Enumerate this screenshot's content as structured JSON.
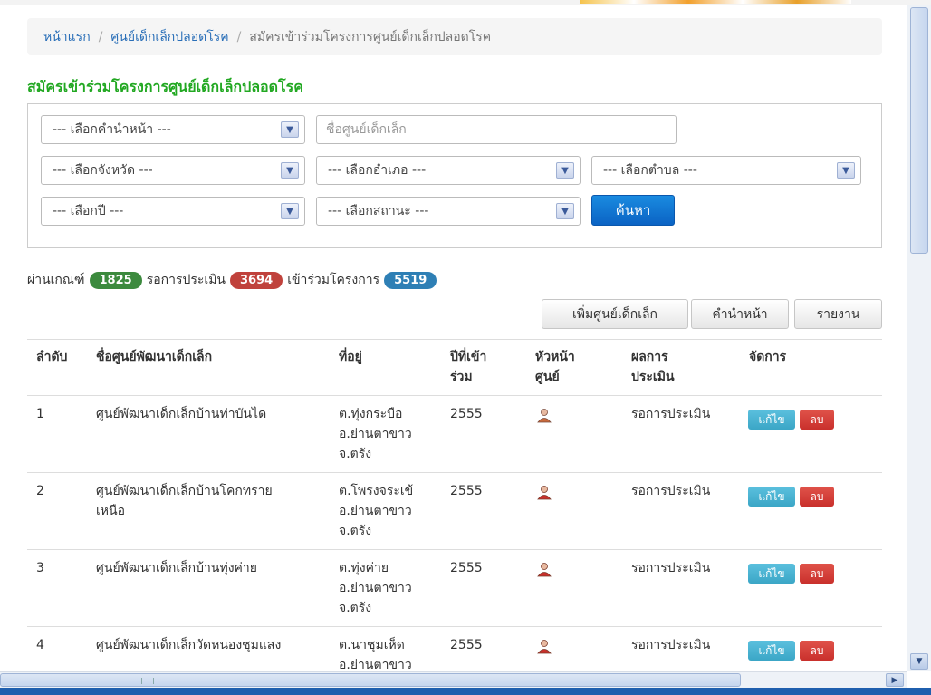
{
  "breadcrumb": {
    "home": "หน้าแรก",
    "section": "ศูนย์เด็กเล็กปลอดโรค",
    "current": "สมัครเข้าร่วมโครงการศูนย์เด็กเล็กปลอดโรค"
  },
  "heading": "สมัครเข้าร่วมโครงการศูนย์เด็กเล็กปลอดโรค",
  "filters": {
    "prefix": "--- เลือกคำนำหน้า ---",
    "center_name_placeholder": "ชื่อศูนย์เด็กเล็ก",
    "province": "--- เลือกจังหวัด ---",
    "district": "--- เลือกอำเภอ ---",
    "subdistrict": "--- เลือกตำบล ---",
    "year": "--- เลือกปี ---",
    "status": "--- เลือกสถานะ ---",
    "search_label": "ค้นหา"
  },
  "summary": {
    "passed_label": "ผ่านเกณฑ์",
    "passed_count": "1825",
    "pending_label": "รอการประเมิน",
    "pending_count": "3694",
    "joined_label": "เข้าร่วมโครงการ",
    "joined_count": "5519"
  },
  "actions": {
    "add_center": "เพิ่มศูนย์เด็กเล็ก",
    "prefix": "คำนำหน้า",
    "report": "รายงาน"
  },
  "table": {
    "headers": {
      "no": "ลำดับ",
      "name": "ชื่อศูนย์พัฒนาเด็กเล็ก",
      "address": "ที่อยู่",
      "year_1": "ปีที่เข้า",
      "year_2": "ร่วม",
      "head_1": "หัวหน้า",
      "head_2": "ศูนย์",
      "result_1": "ผลการ",
      "result_2": "ประเมิน",
      "manage": "จัดการ"
    },
    "rows": [
      {
        "no": "1",
        "name_1": "ศูนย์พัฒนาเด็กเล็กบ้านท่าบันได",
        "name_2": "",
        "addr_1": "ต.ทุ่งกระบือ",
        "addr_2": "อ.ย่านตาขาว",
        "addr_3": "จ.ตรัง",
        "year": "2555",
        "result": "รอการประเมิน",
        "edit": "แก้ไข",
        "delete": "ลบ"
      },
      {
        "no": "2",
        "name_1": "ศูนย์พัฒนาเด็กเล็กบ้านโคกทราย",
        "name_2": "เหนือ",
        "addr_1": "ต.โพรงจระเข้",
        "addr_2": "อ.ย่านตาขาว",
        "addr_3": "จ.ตรัง",
        "year": "2555",
        "result": "รอการประเมิน",
        "edit": "แก้ไข",
        "delete": "ลบ"
      },
      {
        "no": "3",
        "name_1": "ศูนย์พัฒนาเด็กเล็กบ้านทุ่งค่าย",
        "name_2": "",
        "addr_1": "ต.ทุ่งค่าย",
        "addr_2": "อ.ย่านตาขาว",
        "addr_3": "จ.ตรัง",
        "year": "2555",
        "result": "รอการประเมิน",
        "edit": "แก้ไข",
        "delete": "ลบ"
      },
      {
        "no": "4",
        "name_1": "ศูนย์พัฒนาเด็กเล็กวัดหนองชุมแสง",
        "name_2": "",
        "addr_1": "ต.นาชุมเห็ด",
        "addr_2": "อ.ย่านตาขาว",
        "addr_3": "",
        "year": "2555",
        "result": "รอการประเมิน",
        "edit": "แก้ไข",
        "delete": "ลบ"
      }
    ]
  }
}
